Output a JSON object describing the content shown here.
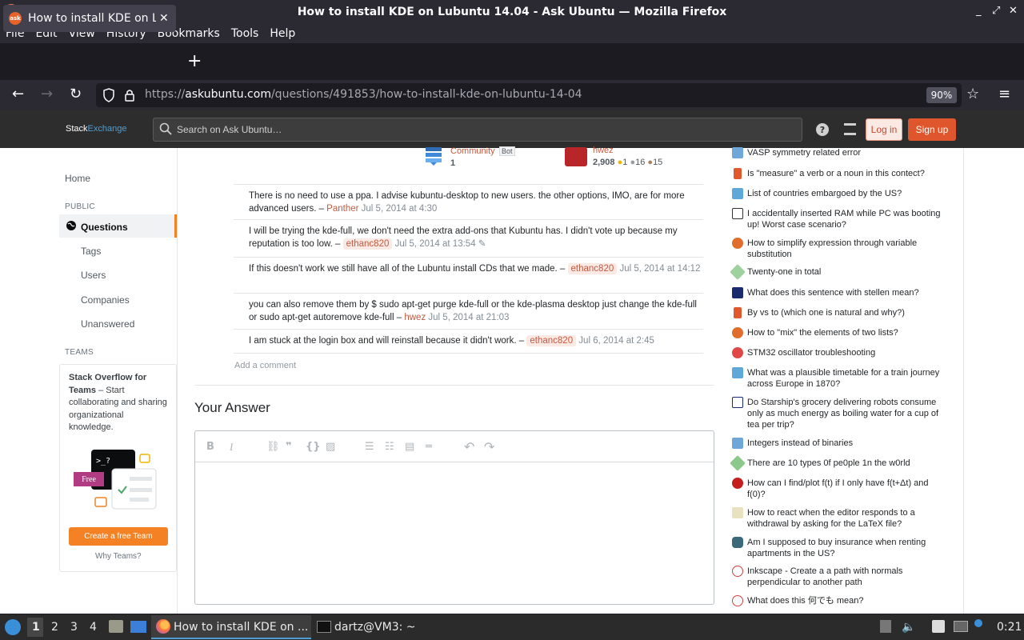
{
  "window": {
    "title": "How to install KDE on Lubuntu 14.04 - Ask Ubuntu — Mozilla Firefox",
    "controls": [
      "_",
      "⤢",
      "✕"
    ]
  },
  "menu": [
    "File",
    "Edit",
    "View",
    "History",
    "Bookmarks",
    "Tools",
    "Help"
  ],
  "tab": {
    "title": "How to install KDE on Lubuntu 14.04 - Ask Ubuntu",
    "favicon": "ask",
    "close": "✕",
    "new_tab": "+"
  },
  "nav": {
    "url_prefix": "https://",
    "url_host": "askubuntu.com",
    "url_path": "/questions/491853/how-to-install-kde-on-lubuntu-14-04",
    "zoom": "90%"
  },
  "se_header": {
    "logo_a": "Stack",
    "logo_b": "Exchange",
    "search_placeholder": "Search on Ask Ubuntu…",
    "login": "Log in",
    "signup": "Sign up"
  },
  "left_nav": {
    "home": "Home",
    "public_label": "PUBLIC",
    "questions": "Questions",
    "tags": "Tags",
    "users": "Users",
    "companies": "Companies",
    "unanswered": "Unanswered",
    "teams_label": "TEAMS",
    "teams_title": "Stack Overflow for Teams",
    "teams_body": " – Start collaborating and sharing organizational knowledge.",
    "free_badge": "Free",
    "create_team": "Create a free Team",
    "why_teams": "Why Teams?"
  },
  "post_signatures": {
    "community_name": "Community",
    "community_badge": "Bot",
    "community_rep": "1",
    "author_name": "hwez",
    "author_rep": "2,908",
    "gold": "1",
    "silver": "16",
    "bronze": "15"
  },
  "comments": [
    {
      "text": "There is no need to use a ppa. I advise kubuntu-desktop to new users. the other options, IMO, are for more advanced users. – ",
      "user": "Panther",
      "date": "Jul 5, 2014 at 4:30"
    },
    {
      "text": "I will be trying the kde-full, we don't need the extra add-ons that Kubuntu has. I didn't vote up because my reputation is too low. – ",
      "user": "ethanc820",
      "date": "Jul 5, 2014 at 13:54"
    },
    {
      "text": "If this doesn't work we still have all of the Lubuntu install CDs that we made. – ",
      "user": "ethanc820",
      "date": "Jul 5, 2014 at 14:12"
    },
    {
      "text": "you can also remove them by $ sudo apt-get purge kde-full or the kde-plasma desktop just change the kde-full or sudo apt-get autoremove kde-full – ",
      "user": "hwez",
      "date": "Jul 5, 2014 at 21:03"
    },
    {
      "text": "I am stuck at the login box and will reinstall because it didn't work. – ",
      "user": "ethanc820",
      "date": "Jul 6, 2014 at 2:45"
    }
  ],
  "add_comment": "Add a comment",
  "your_answer": "Your Answer",
  "hot_questions": [
    "VASP symmetry related error",
    "Is \"measure\" a verb or a noun in this contect?",
    "List of countries embargoed by the US?",
    "I accidentally inserted RAM while PC was booting up! Worst case scenario?",
    "How to simplify expression through variable substitution",
    "Twenty-one in total",
    "What does this sentence with stellen mean?",
    "By vs to (which one is natural and why?)",
    "How to \"mix\" the elements of two lists?",
    "STM32 oscillator troubleshooting",
    "What was a plausible timetable for a train journey across Europe in 1870?",
    "Do Starship's grocery delivering robots consume only as much energy as boiling water for a cup of tea per trip?",
    "Integers instead of binaries",
    "There are 10 types 0f pe0ple 1n the w0rld",
    "How can I find/plot f(t) if I only have f(t+Δt) and f(0)?",
    "How to react when the editor responds to a withdrawal by asking for the LaTeX file?",
    "Am I supposed to buy insurance when renting apartments in the US?",
    "Inkscape - Create a a path with normals perpendicular to another path",
    "What does this 何でも mean?"
  ],
  "taskbar": {
    "desktops": [
      "1",
      "2",
      "3",
      "4"
    ],
    "firefox_task": "How to install KDE on ...",
    "terminal_task": "dartz@VM3: ~",
    "clock": "0:21"
  },
  "colors": {
    "accent": "#f48225",
    "link": "#c4593f",
    "firefox_bg": "#2b2a33"
  }
}
